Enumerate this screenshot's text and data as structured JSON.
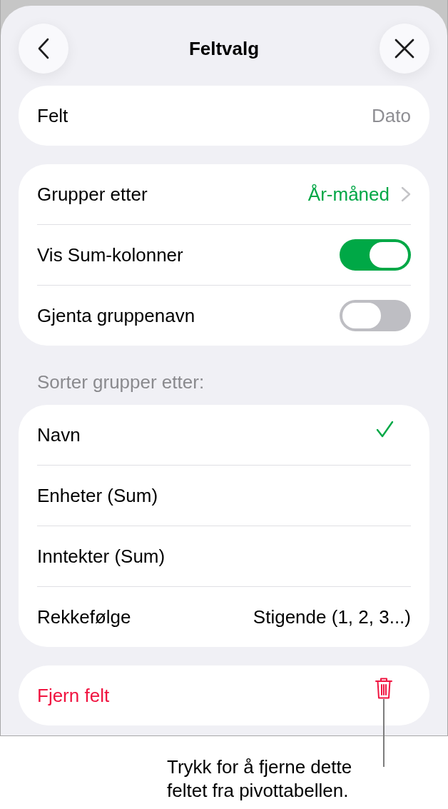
{
  "header": {
    "title": "Feltvalg"
  },
  "field_row": {
    "label": "Felt",
    "value": "Dato"
  },
  "group_settings": [
    {
      "kind": "link",
      "label": "Grupper etter",
      "value": "År-måned"
    },
    {
      "kind": "toggle",
      "label": "Vis Sum-kolonner",
      "on": true
    },
    {
      "kind": "toggle",
      "label": "Gjenta gruppenavn",
      "on": false
    }
  ],
  "sort_section": {
    "heading": "Sorter grupper etter:",
    "options": [
      {
        "label": "Navn",
        "selected": true
      },
      {
        "label": "Enheter (Sum)",
        "selected": false
      },
      {
        "label": "Inntekter (Sum)",
        "selected": false
      }
    ],
    "order": {
      "label": "Rekkefølge",
      "value": "Stigende (1, 2, 3...)"
    }
  },
  "remove_row": {
    "label": "Fjern felt"
  },
  "callout": {
    "text": "Trykk for å fjerne dette feltet fra pivottabellen."
  }
}
